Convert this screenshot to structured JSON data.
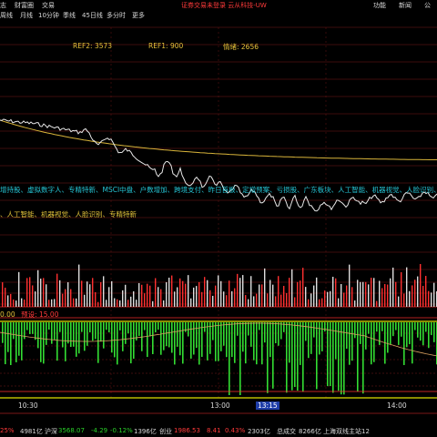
{
  "menu": {
    "items_left": [
      "志",
      "财富圈",
      "交易"
    ],
    "notice": "证券交易未登录  云从科技-UW",
    "items_right": [
      "功能",
      "新闻",
      "公"
    ]
  },
  "periods": [
    "周线",
    "月线",
    "10分钟",
    "季线",
    "45日线",
    "多分时",
    "更多"
  ],
  "refs": {
    "ref2": "REF2: 3573",
    "ref1": "REF1: 900",
    "emotion": "情绪: 2656"
  },
  "concepts": {
    "line1": "增持股、虚拟数字人、专精特新、MSCI中盘、户数增加、跨境支付、昨日首板、定增预案、亏损股、广东板块、人工智能、机器视觉、人脸识别、",
    "line2": "、人工智能、机器视觉、人脸识别、专精特新"
  },
  "volume_label": {
    "value": "0.00",
    "label": "预设: 15.00"
  },
  "time_axis": [
    "10:30",
    "13:00",
    "13:15",
    "14:00"
  ],
  "status": {
    "pct1": "25%",
    "amt1": "4981亿",
    "sh_label": "沪深",
    "sh_price": "3568.07",
    "sh_change": "-4.29",
    "sh_pct": "-0.12%",
    "sh_amt": "1396亿",
    "cy_label": "创业",
    "cy_price": "1986.53",
    "cy_change": "8.41",
    "cy_pct": "0.43%",
    "cy_amt": "2303亿",
    "total_label": "总成交",
    "total_amt": "8266亿",
    "station": "上海双线主站12"
  },
  "colors": {
    "background": "#000000",
    "grid_red": "#8a1a1a",
    "price_white": "#e8e8e8",
    "avg_yellow": "#d8b43a",
    "vol_red": "#ff3030",
    "vol_green": "#33dd33",
    "concept_cyan": "#25c4d4"
  }
}
